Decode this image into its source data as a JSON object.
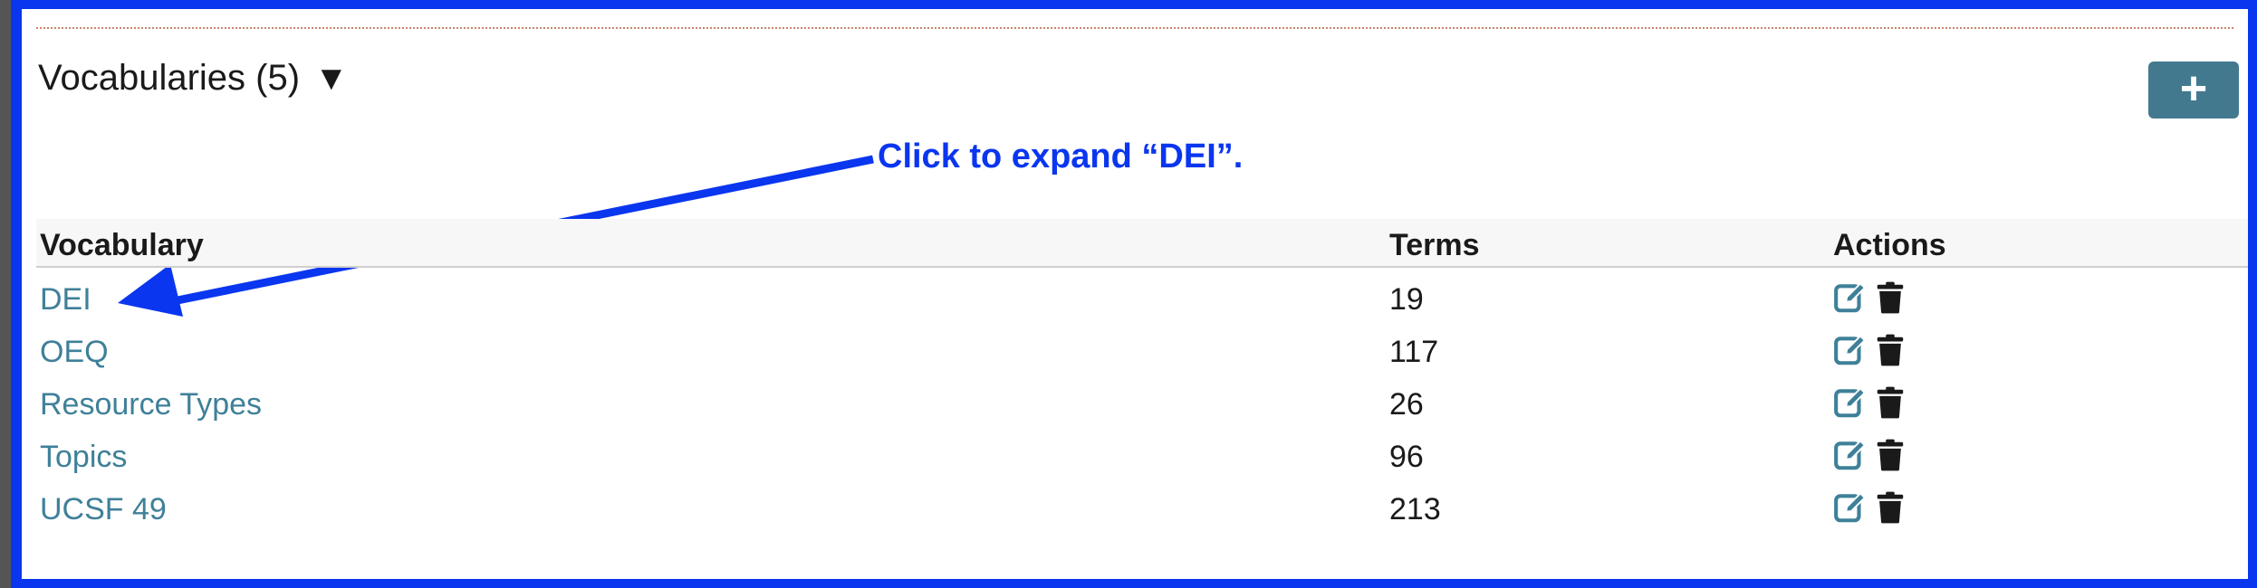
{
  "section": {
    "title": "Vocabularies (5)",
    "caret": "▼",
    "add_label": "+"
  },
  "annotation": {
    "text": "Click to expand “DEI”."
  },
  "table": {
    "columns": [
      "Vocabulary",
      "Terms",
      "Actions"
    ],
    "rows": [
      {
        "name": "DEI",
        "terms": "19"
      },
      {
        "name": "OEQ",
        "terms": "117"
      },
      {
        "name": "Resource Types",
        "terms": "26"
      },
      {
        "name": "Topics",
        "terms": "96"
      },
      {
        "name": "UCSF 49",
        "terms": "213"
      }
    ]
  },
  "icons": {
    "edit": "edit-icon",
    "delete": "trash-icon",
    "caret": "triangle-down-icon"
  },
  "colors": {
    "link": "#3f8099",
    "button": "#43798f",
    "annotation": "#0a36ef",
    "delete_icon": "#1a1a1a"
  }
}
